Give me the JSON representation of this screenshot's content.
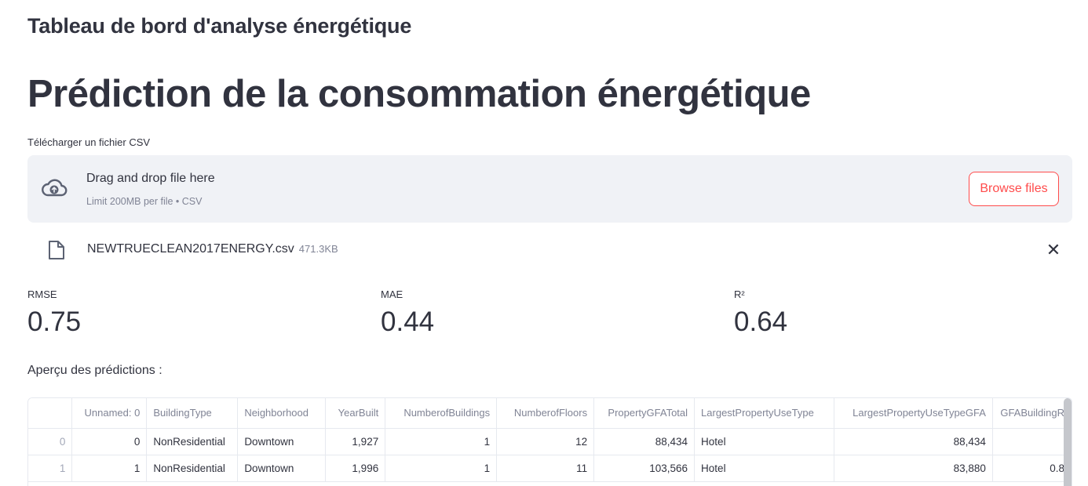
{
  "app_title": "Tableau de bord d'analyse énergétique",
  "page_title": "Prédiction de la consommation énergétique",
  "upload": {
    "label": "Télécharger un fichier CSV",
    "dropzone_main": "Drag and drop file here",
    "dropzone_sub": "Limit 200MB per file • CSV",
    "browse_label": "Browse files",
    "cloud_icon": "cloud-upload-icon"
  },
  "file": {
    "name": "NEWTRUECLEAN2017ENERGY.csv",
    "size": "471.3KB",
    "close_label": "✕"
  },
  "metrics": [
    {
      "label": "RMSE",
      "value": "0.75"
    },
    {
      "label": "MAE",
      "value": "0.44"
    },
    {
      "label": "R²",
      "value": "0.64"
    }
  ],
  "preview_label": "Aperçu des prédictions :",
  "table": {
    "headers": [
      "",
      "Unnamed: 0",
      "BuildingType",
      "Neighborhood",
      "YearBuilt",
      "NumberofBuildings",
      "NumberofFloors",
      "PropertyGFATotal",
      "LargestPropertyUseType",
      "LargestPropertyUseTypeGFA",
      "GFABuildingR"
    ],
    "rows": [
      [
        "0",
        "0",
        "NonResidential",
        "Downtown",
        "1,927",
        "1",
        "12",
        "88,434",
        "Hotel",
        "88,434",
        ""
      ],
      [
        "1",
        "1",
        "NonResidential",
        "Downtown",
        "1,996",
        "1",
        "11",
        "103,566",
        "Hotel",
        "83,880",
        "0.8"
      ]
    ]
  },
  "colors": {
    "accent": "#ff4b4b",
    "dropzone_bg": "#f0f2f6",
    "muted_text": "#808495"
  }
}
